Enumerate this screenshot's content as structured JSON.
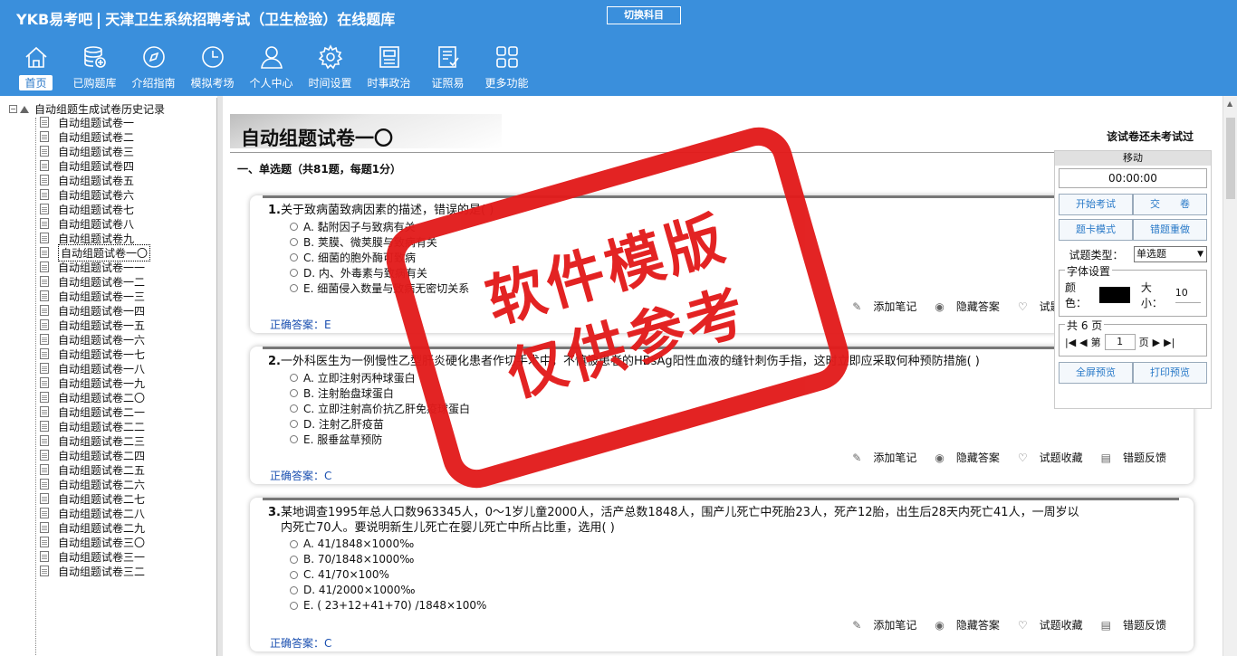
{
  "header": {
    "logo": "YKB易考吧",
    "app_title": "天津卫生系统招聘考试（卫生检验）在线题库",
    "switch_subject": "切换科目"
  },
  "nav": [
    {
      "label": "首页",
      "icon": "home-icon",
      "active": true
    },
    {
      "label": "已购题库",
      "icon": "database-icon"
    },
    {
      "label": "介绍指南",
      "icon": "compass-icon"
    },
    {
      "label": "模拟考场",
      "icon": "clock-icon"
    },
    {
      "label": "个人中心",
      "icon": "user-icon"
    },
    {
      "label": "时间设置",
      "icon": "gear-icon"
    },
    {
      "label": "时事政治",
      "icon": "newspaper-icon"
    },
    {
      "label": "证照易",
      "icon": "checklist-icon"
    },
    {
      "label": "更多功能",
      "icon": "grid-icon"
    }
  ],
  "tree": {
    "root": "自动组题生成试卷历史记录",
    "items": [
      "自动组题试卷一",
      "自动组题试卷二",
      "自动组题试卷三",
      "自动组题试卷四",
      "自动组题试卷五",
      "自动组题试卷六",
      "自动组题试卷七",
      "自动组题试卷八",
      "自动组题试卷九",
      "自动组题试卷一〇",
      "自动组题试卷一一",
      "自动组题试卷一二",
      "自动组题试卷一三",
      "自动组题试卷一四",
      "自动组题试卷一五",
      "自动组题试卷一六",
      "自动组题试卷一七",
      "自动组题试卷一八",
      "自动组题试卷一九",
      "自动组题试卷二〇",
      "自动组题试卷二一",
      "自动组题试卷二二",
      "自动组题试卷二三",
      "自动组题试卷二四",
      "自动组题试卷二五",
      "自动组题试卷二六",
      "自动组题试卷二七",
      "自动组题试卷二八",
      "自动组题试卷二九",
      "自动组题试卷三〇",
      "自动组题试卷三一",
      "自动组题试卷三二"
    ],
    "selected_index": 9
  },
  "main": {
    "paper_title": "自动组题试卷一〇",
    "status": "该试卷还未考试过",
    "section_title": "一、单选题（共81题，每题1分）",
    "actions": {
      "note": "添加笔记",
      "hide": "隐藏答案",
      "fav": "试题收藏",
      "feedback": "错题反馈"
    },
    "answer_label": "正确答案：",
    "questions": [
      {
        "num": "1.",
        "text": "关于致病菌致病因素的描述，错误的是( )",
        "text2": "",
        "options": [
          "A. 黏附因子与致病有关",
          "B. 荚膜、微荚膜与致病有关",
          "C. 细菌的胞外酶可致病",
          "D. 内、外毒素与致病有关",
          "E. 细菌侵入数量与致病无密切关系"
        ],
        "answer": "E"
      },
      {
        "num": "2.",
        "text": "一外科医生为一例慢性乙型肝炎硬化患者作切手术中，不慎被患者的HBsAg阳性血液的缝针刺伤手指，这时立即应采取何种预防措施( )",
        "text2": "",
        "options": [
          "A. 立即注射丙种球蛋白",
          "B. 注射胎盘球蛋白",
          "C. 立即注射高价抗乙肝免疫球蛋白",
          "D. 注射乙肝疫苗",
          "E. 服垂盆草预防"
        ],
        "answer": "C"
      },
      {
        "num": "3.",
        "text": "某地调查1995年总人口数963345人，0～1岁儿童2000人，活产总数1848人，围产儿死亡中死胎23人，死产12胎，出生后28天内死亡41人，一周岁以",
        "text2": "内死亡70人。要说明新生儿死亡在婴儿死亡中所占比重，选用( )",
        "options": [
          "A. 41/1848×1000‰",
          "B. 70/1848×1000‰",
          "C. 41/70×100%",
          "D. 41/2000×1000‰",
          "E. ( 23+12+41+70) /1848×100%"
        ],
        "answer": "C"
      }
    ]
  },
  "panel": {
    "move": "移动",
    "timer": "00:00:00",
    "start": "开始考试",
    "submit": "交　　卷",
    "card_mode": "题卡模式",
    "redo_wrong": "错题重做",
    "type_label": "试题类型：",
    "type_value": "单选题",
    "font_legend": "字体设置",
    "color_label": "颜色：",
    "size_label": "大小：",
    "size_value": "10",
    "pages_legend": "共 6 页",
    "page_prefix": "第",
    "page_value": "1",
    "page_suffix": "页",
    "fullscreen": "全屏预览",
    "print": "打印预览",
    "color_value": "#000000"
  },
  "watermark": {
    "line1": "软件模版",
    "line2": "仅供参考"
  }
}
